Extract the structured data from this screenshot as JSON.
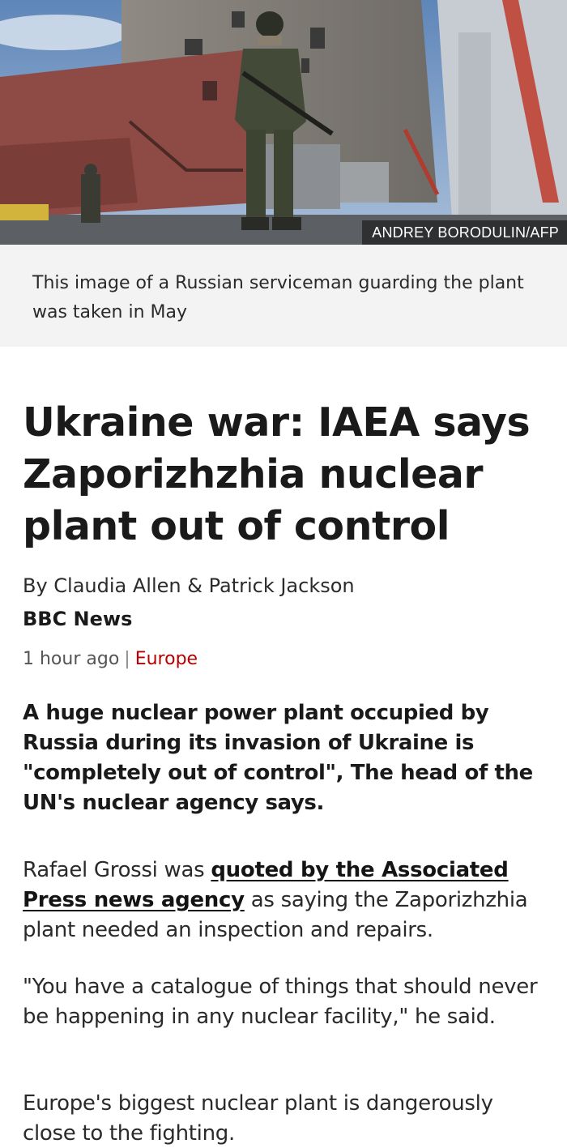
{
  "hero": {
    "photo_credit": "ANDREY BORODULIN/AFP",
    "caption": "This image of a Russian serviceman guarding the plant was taken in May"
  },
  "article": {
    "headline": "Ukraine war: IAEA says Zaporizhzhia nuclear plant out of control",
    "byline": "By Claudia Allen & Patrick Jackson",
    "outlet": "BBC News",
    "timestamp": "1 hour ago",
    "separator": "|",
    "topic": "Europe",
    "intro": "A huge nuclear power plant occupied by Russia during its invasion of Ukraine is \"completely out of control\", The head of the UN's nuclear agency says.",
    "p1_before": "Rafael Grossi was ",
    "p1_link": "quoted by the Associated Press news agency",
    "p1_after": " as saying the Zaporizhzhia plant needed an inspection and repairs.",
    "p2": "\"You have a catalogue of things that should never be happening in any nuclear facility,\" he said.",
    "p3": "Europe's biggest nuclear plant is dangerously close to the fighting."
  },
  "colors": {
    "topic": "#b80000",
    "caption_bg": "#f3f3f3"
  }
}
